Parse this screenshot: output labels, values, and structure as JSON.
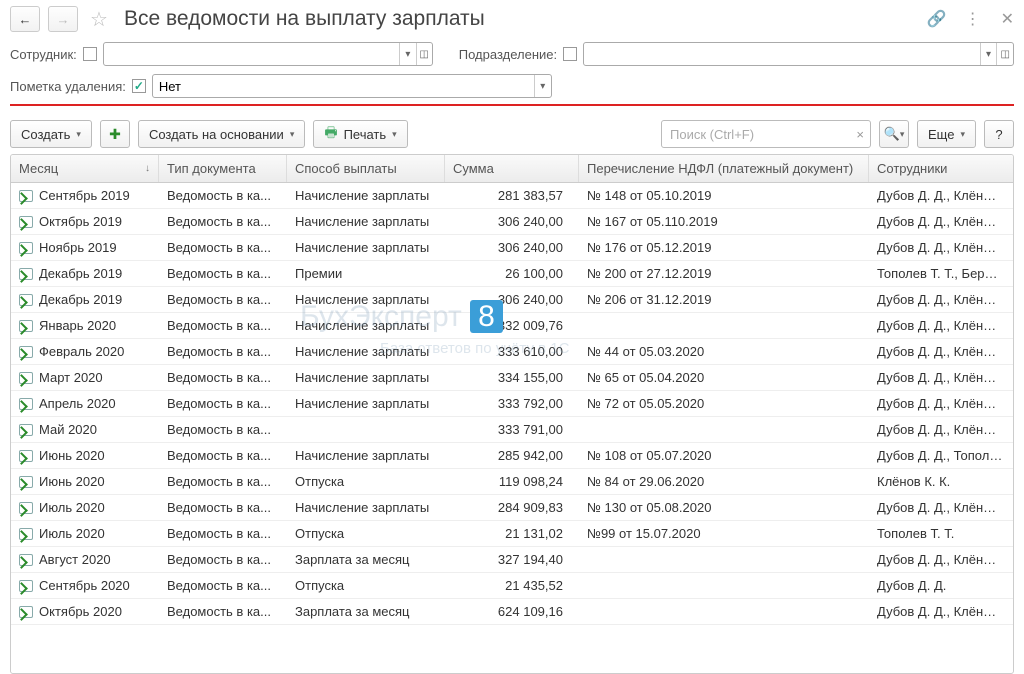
{
  "header": {
    "title": "Все ведомости на выплату зарплаты"
  },
  "filters": {
    "employee_label": "Сотрудник:",
    "dept_label": "Подразделение:",
    "delmark_label": "Пометка удаления:",
    "delmark_value": "Нет"
  },
  "toolbar": {
    "create": "Создать",
    "create_based": "Создать на основании",
    "print": "Печать",
    "search_placeholder": "Поиск (Ctrl+F)",
    "more": "Еще",
    "help": "?"
  },
  "columns": {
    "month": "Месяц",
    "type": "Тип документа",
    "method": "Способ выплаты",
    "sum": "Сумма",
    "ndfl": "Перечисление НДФЛ (платежный документ)",
    "employees": "Сотрудники"
  },
  "rows": [
    {
      "month": "Сентябрь 2019",
      "type": "Ведомость в ка...",
      "method": "Начисление зарплаты",
      "sum": "281 383,57",
      "ndfl": "№ 148 от 05.10.2019",
      "emp": "Дубов Д. Д., Клёнов К."
    },
    {
      "month": "Октябрь 2019",
      "type": "Ведомость в ка...",
      "method": "Начисление зарплаты",
      "sum": "306 240,00",
      "ndfl": "№ 167 от 05.110.2019",
      "emp": "Дубов Д. Д., Клёнов К."
    },
    {
      "month": "Ноябрь 2019",
      "type": "Ведомость в ка...",
      "method": "Начисление зарплаты",
      "sum": "306 240,00",
      "ndfl": "№ 176 от 05.12.2019",
      "emp": "Дубов Д. Д., Клёнов К."
    },
    {
      "month": "Декабрь 2019",
      "type": "Ведомость в ка...",
      "method": "Премии",
      "sum": "26 100,00",
      "ndfl": "№ 200 от 27.12.2019",
      "emp": "Тополев Т. Т., Берёзкин"
    },
    {
      "month": "Декабрь 2019",
      "type": "Ведомость в ка...",
      "method": "Начисление зарплаты",
      "sum": "306 240,00",
      "ndfl": "№ 206 от 31.12.2019",
      "emp": "Дубов Д. Д., Клёнов К."
    },
    {
      "month": "Январь 2020",
      "type": "Ведомость в ка...",
      "method": "Начисление зарплаты",
      "sum": "332 009,76",
      "ndfl": "",
      "emp": "Дубов Д. Д., Клёнов К."
    },
    {
      "month": "Февраль 2020",
      "type": "Ведомость в ка...",
      "method": "Начисление зарплаты",
      "sum": "333 610,00",
      "ndfl": "№ 44 от 05.03.2020",
      "emp": "Дубов Д. Д., Клёнов К."
    },
    {
      "month": "Март 2020",
      "type": "Ведомость в ка...",
      "method": "Начисление зарплаты",
      "sum": "334 155,00",
      "ndfl": "№ 65 от 05.04.2020",
      "emp": "Дубов Д. Д., Клёнов К."
    },
    {
      "month": "Апрель 2020",
      "type": "Ведомость в ка...",
      "method": "Начисление зарплаты",
      "sum": "333 792,00",
      "ndfl": "№ 72 от 05.05.2020",
      "emp": "Дубов Д. Д., Клёнов К."
    },
    {
      "month": "Май 2020",
      "type": "Ведомость в ка...",
      "method": "",
      "sum": "333 791,00",
      "ndfl": "",
      "emp": "Дубов Д. Д., Клёнов К."
    },
    {
      "month": "Июнь 2020",
      "type": "Ведомость в ка...",
      "method": "Начисление зарплаты",
      "sum": "285 942,00",
      "ndfl": "№ 108 от 05.07.2020",
      "emp": "Дубов Д. Д., Тополев Т."
    },
    {
      "month": "Июнь 2020",
      "type": "Ведомость в ка...",
      "method": "Отпуска",
      "sum": "119 098,24",
      "ndfl": "№ 84 от 29.06.2020",
      "emp": "Клёнов К. К."
    },
    {
      "month": "Июль 2020",
      "type": "Ведомость в ка...",
      "method": "Начисление зарплаты",
      "sum": "284 909,83",
      "ndfl": "№ 130 от 05.08.2020",
      "emp": "Дубов Д. Д., Клёнов К."
    },
    {
      "month": "Июль 2020",
      "type": "Ведомость в ка...",
      "method": "Отпуска",
      "sum": "21 131,02",
      "ndfl": "№99 от 15.07.2020",
      "emp": "Тополев Т. Т."
    },
    {
      "month": "Август 2020",
      "type": "Ведомость в ка...",
      "method": "Зарплата за месяц",
      "sum": "327 194,40",
      "ndfl": "",
      "emp": "Дубов Д. Д., Клёнов К."
    },
    {
      "month": "Сентябрь 2020",
      "type": "Ведомость в ка...",
      "method": "Отпуска",
      "sum": "21 435,52",
      "ndfl": "",
      "emp": "Дубов Д. Д."
    },
    {
      "month": "Октябрь 2020",
      "type": "Ведомость в ка...",
      "method": "Зарплата за месяц",
      "sum": "624 109,16",
      "ndfl": "",
      "emp": "Дубов Д. Д., Клёнов К."
    }
  ]
}
